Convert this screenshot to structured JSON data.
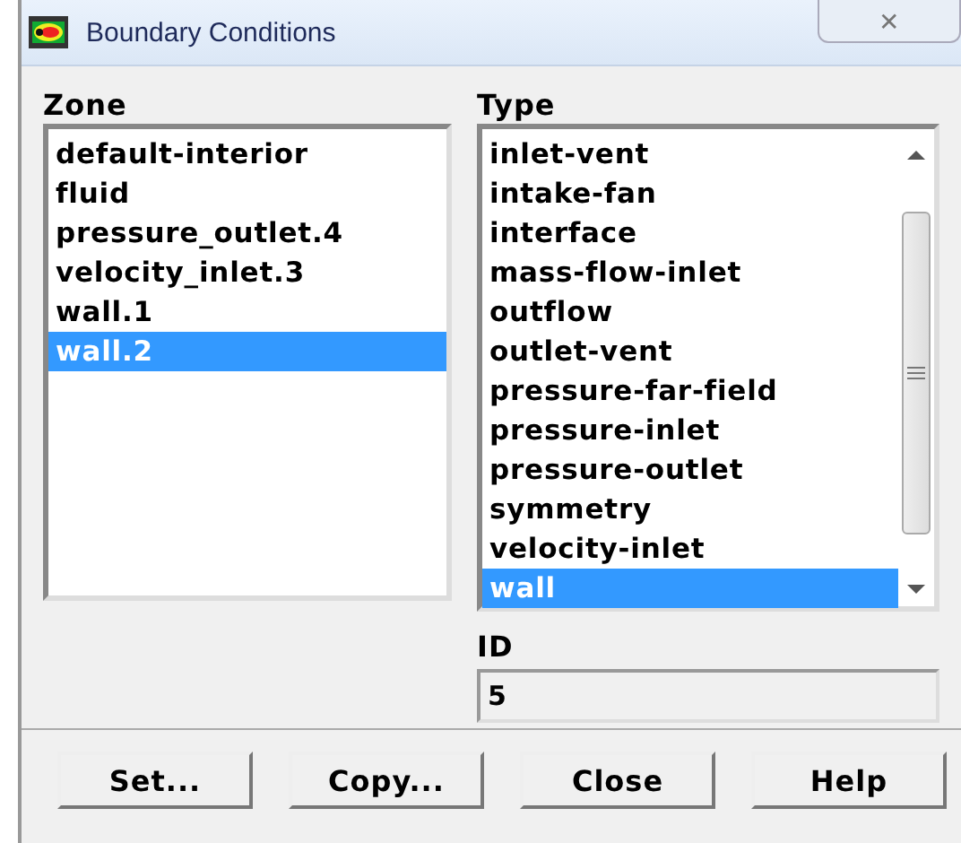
{
  "window": {
    "title": "Boundary Conditions",
    "close": "✕"
  },
  "zone": {
    "label": "Zone",
    "items": [
      {
        "label": "default-interior",
        "selected": false
      },
      {
        "label": "fluid",
        "selected": false
      },
      {
        "label": "pressure_outlet.4",
        "selected": false
      },
      {
        "label": "velocity_inlet.3",
        "selected": false
      },
      {
        "label": "wall.1",
        "selected": false
      },
      {
        "label": "wall.2",
        "selected": true
      }
    ]
  },
  "type": {
    "label": "Type",
    "items": [
      {
        "label": "inlet-vent",
        "selected": false
      },
      {
        "label": "intake-fan",
        "selected": false
      },
      {
        "label": "interface",
        "selected": false
      },
      {
        "label": "mass-flow-inlet",
        "selected": false
      },
      {
        "label": "outflow",
        "selected": false
      },
      {
        "label": "outlet-vent",
        "selected": false
      },
      {
        "label": "pressure-far-field",
        "selected": false
      },
      {
        "label": "pressure-inlet",
        "selected": false
      },
      {
        "label": "pressure-outlet",
        "selected": false
      },
      {
        "label": "symmetry",
        "selected": false
      },
      {
        "label": "velocity-inlet",
        "selected": false
      },
      {
        "label": "wall",
        "selected": true
      }
    ]
  },
  "id": {
    "label": "ID",
    "value": "5"
  },
  "buttons": [
    "Set...",
    "Copy...",
    "Close",
    "Help"
  ]
}
